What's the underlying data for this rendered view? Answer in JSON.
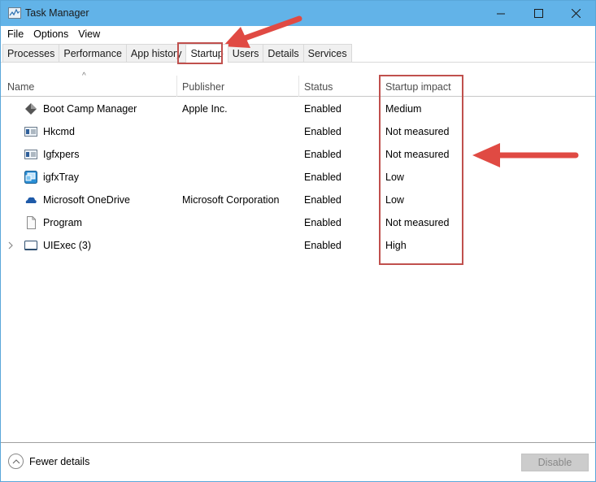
{
  "window": {
    "title": "Task Manager",
    "controls": {
      "minimize": "minimize",
      "maximize": "maximize",
      "close": "close"
    }
  },
  "menu": [
    "File",
    "Options",
    "View"
  ],
  "tabs": [
    {
      "label": "Processes",
      "active": false
    },
    {
      "label": "Performance",
      "active": false
    },
    {
      "label": "App history",
      "active": false
    },
    {
      "label": "Startup",
      "active": true
    },
    {
      "label": "Users",
      "active": false
    },
    {
      "label": "Details",
      "active": false
    },
    {
      "label": "Services",
      "active": false
    }
  ],
  "table": {
    "sort_indicator": "^",
    "columns": [
      "Name",
      "Publisher",
      "Status",
      "Startup impact"
    ],
    "rows": [
      {
        "name": "Boot Camp Manager",
        "publisher": "Apple Inc.",
        "status": "Enabled",
        "impact": "Medium",
        "icon": "bootcamp-icon",
        "expandable": false
      },
      {
        "name": "Hkcmd",
        "publisher": "",
        "status": "Enabled",
        "impact": "Not measured",
        "icon": "app-window-icon",
        "expandable": false
      },
      {
        "name": "Igfxpers",
        "publisher": "",
        "status": "Enabled",
        "impact": "Not measured",
        "icon": "app-window-icon",
        "expandable": false
      },
      {
        "name": "igfxTray",
        "publisher": "",
        "status": "Enabled",
        "impact": "Low",
        "icon": "intel-graphics-icon",
        "expandable": false
      },
      {
        "name": "Microsoft OneDrive",
        "publisher": "Microsoft Corporation",
        "status": "Enabled",
        "impact": "Low",
        "icon": "onedrive-cloud-icon",
        "expandable": false
      },
      {
        "name": "Program",
        "publisher": "",
        "status": "Enabled",
        "impact": "Not measured",
        "icon": "blank-file-icon",
        "expandable": false
      },
      {
        "name": "UIExec (3)",
        "publisher": "",
        "status": "Enabled",
        "impact": "High",
        "icon": "window-frame-icon",
        "expandable": true
      }
    ]
  },
  "footer": {
    "fewer_details_label": "Fewer details",
    "disable_label": "Disable"
  },
  "annotations": {
    "highlight_color": "#c0504d",
    "arrow_color": "#e04a43"
  }
}
